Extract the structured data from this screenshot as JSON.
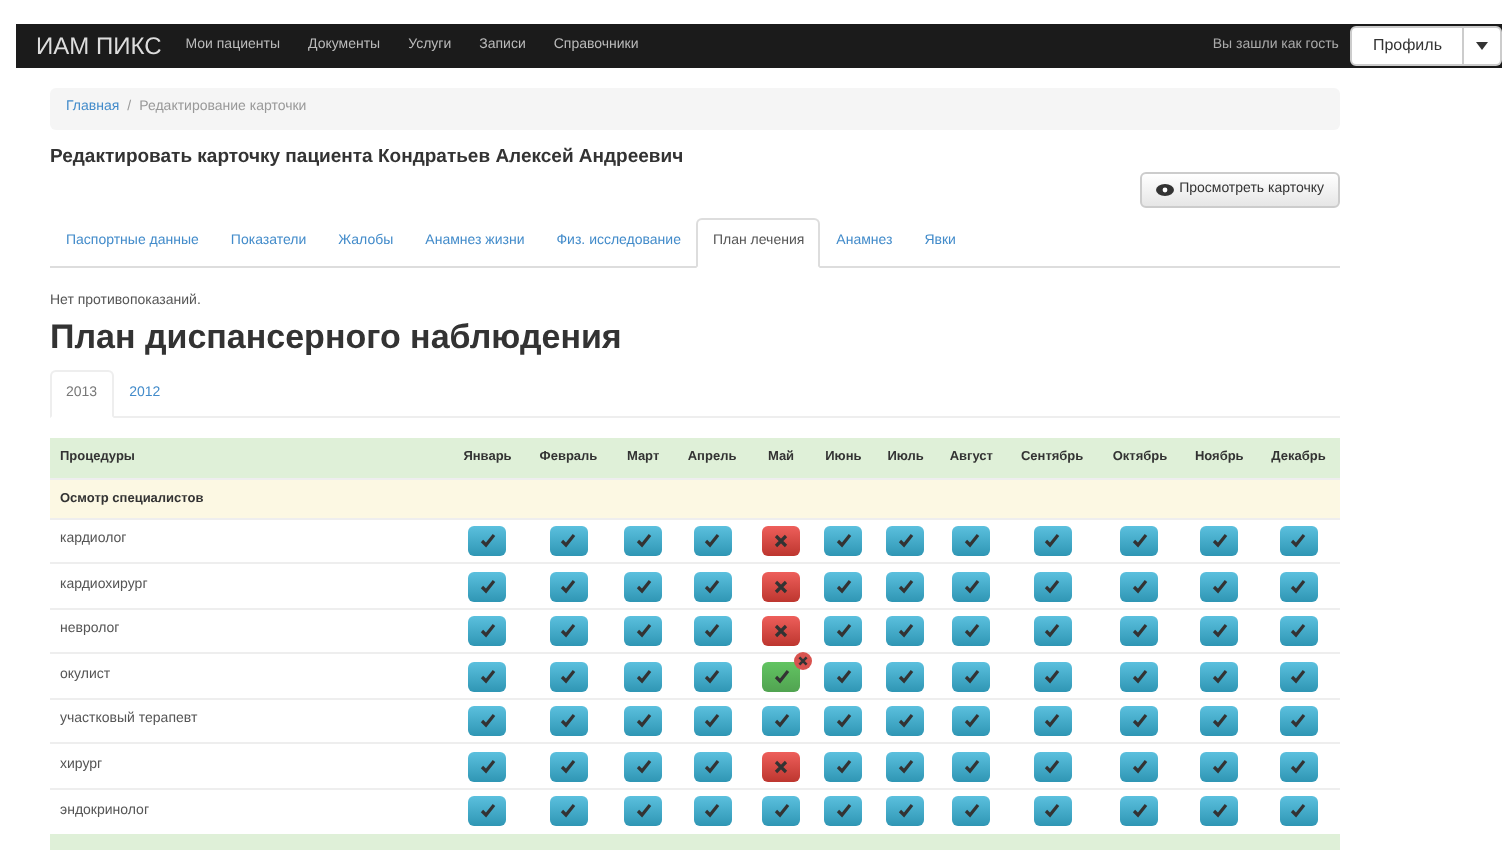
{
  "navbar": {
    "brand": "ИАМ ПИКС",
    "items": [
      "Мои пациенты",
      "Документы",
      "Услуги",
      "Записи",
      "Справочники"
    ],
    "guest_text": "Вы зашли как гость",
    "profile_button": "Профиль"
  },
  "breadcrumb": [
    {
      "label": "Главная",
      "link": true
    },
    {
      "label": "Редактирование карточки",
      "link": false
    }
  ],
  "breadcrumb_separator": "/",
  "page_title": "Редактировать карточку пациента Кондратьев Алексей Андреевич",
  "view_button": "Просмотреть карточку",
  "tabs": [
    {
      "label": "Паспортные данные",
      "selected": false
    },
    {
      "label": "Показатели",
      "selected": false
    },
    {
      "label": "Жалобы",
      "selected": false
    },
    {
      "label": "Анамнез жизни",
      "selected": false
    },
    {
      "label": "Физ. исследование",
      "selected": false
    },
    {
      "label": "План лечения",
      "selected": true
    },
    {
      "label": "Анамнез",
      "selected": false
    },
    {
      "label": "Явки",
      "selected": false
    }
  ],
  "note": "Нет противопоказаний.",
  "heading": "План диспансерного наблюдения",
  "year_tabs": [
    {
      "label": "2013",
      "selected": true
    },
    {
      "label": "2012",
      "selected": false
    }
  ],
  "table": {
    "columns": [
      "Процедуры",
      "Январь",
      "Февраль",
      "Март",
      "Апрель",
      "Май",
      "Июнь",
      "Июль",
      "Август",
      "Сентябрь",
      "Октябрь",
      "Ноябрь",
      "Декабрь"
    ],
    "section": "Осмотр специалистов",
    "rows": [
      {
        "name": "кардиолог",
        "cells": [
          {
            "kind": "planned"
          },
          {
            "kind": "planned"
          },
          {
            "kind": "planned"
          },
          {
            "kind": "planned"
          },
          {
            "kind": "missed"
          },
          {
            "kind": "planned"
          },
          {
            "kind": "planned"
          },
          {
            "kind": "planned"
          },
          {
            "kind": "planned"
          },
          {
            "kind": "planned"
          },
          {
            "kind": "planned"
          },
          {
            "kind": "planned"
          }
        ]
      },
      {
        "name": "кардиохирург",
        "cells": [
          {
            "kind": "planned"
          },
          {
            "kind": "planned"
          },
          {
            "kind": "planned"
          },
          {
            "kind": "planned"
          },
          {
            "kind": "missed"
          },
          {
            "kind": "planned"
          },
          {
            "kind": "planned"
          },
          {
            "kind": "planned"
          },
          {
            "kind": "planned"
          },
          {
            "kind": "planned"
          },
          {
            "kind": "planned"
          },
          {
            "kind": "planned"
          }
        ]
      },
      {
        "name": "невролог",
        "cells": [
          {
            "kind": "planned"
          },
          {
            "kind": "planned"
          },
          {
            "kind": "planned"
          },
          {
            "kind": "planned"
          },
          {
            "kind": "missed"
          },
          {
            "kind": "planned"
          },
          {
            "kind": "planned"
          },
          {
            "kind": "planned"
          },
          {
            "kind": "planned"
          },
          {
            "kind": "planned"
          },
          {
            "kind": "planned"
          },
          {
            "kind": "planned"
          }
        ]
      },
      {
        "name": "окулист",
        "cells": [
          {
            "kind": "planned"
          },
          {
            "kind": "planned"
          },
          {
            "kind": "planned"
          },
          {
            "kind": "planned"
          },
          {
            "kind": "done"
          },
          {
            "kind": "planned"
          },
          {
            "kind": "planned"
          },
          {
            "kind": "planned"
          },
          {
            "kind": "planned"
          },
          {
            "kind": "planned"
          },
          {
            "kind": "planned"
          },
          {
            "kind": "planned"
          }
        ]
      },
      {
        "name": "участковый терапевт",
        "cells": [
          {
            "kind": "planned"
          },
          {
            "kind": "planned"
          },
          {
            "kind": "planned"
          },
          {
            "kind": "planned"
          },
          {
            "kind": "planned"
          },
          {
            "kind": "planned"
          },
          {
            "kind": "planned"
          },
          {
            "kind": "planned"
          },
          {
            "kind": "planned"
          },
          {
            "kind": "planned"
          },
          {
            "kind": "planned"
          },
          {
            "kind": "planned"
          }
        ]
      },
      {
        "name": "хирург",
        "cells": [
          {
            "kind": "planned"
          },
          {
            "kind": "planned"
          },
          {
            "kind": "planned"
          },
          {
            "kind": "planned"
          },
          {
            "kind": "missed"
          },
          {
            "kind": "planned"
          },
          {
            "kind": "planned"
          },
          {
            "kind": "planned"
          },
          {
            "kind": "planned"
          },
          {
            "kind": "planned"
          },
          {
            "kind": "planned"
          },
          {
            "kind": "planned"
          }
        ]
      },
      {
        "name": "эндокринолог",
        "cells": [
          {
            "kind": "planned"
          },
          {
            "kind": "planned"
          },
          {
            "kind": "planned"
          },
          {
            "kind": "planned"
          },
          {
            "kind": "planned"
          },
          {
            "kind": "planned"
          },
          {
            "kind": "planned"
          },
          {
            "kind": "planned"
          },
          {
            "kind": "planned"
          },
          {
            "kind": "planned"
          },
          {
            "kind": "planned"
          },
          {
            "kind": "planned"
          }
        ]
      }
    ]
  }
}
